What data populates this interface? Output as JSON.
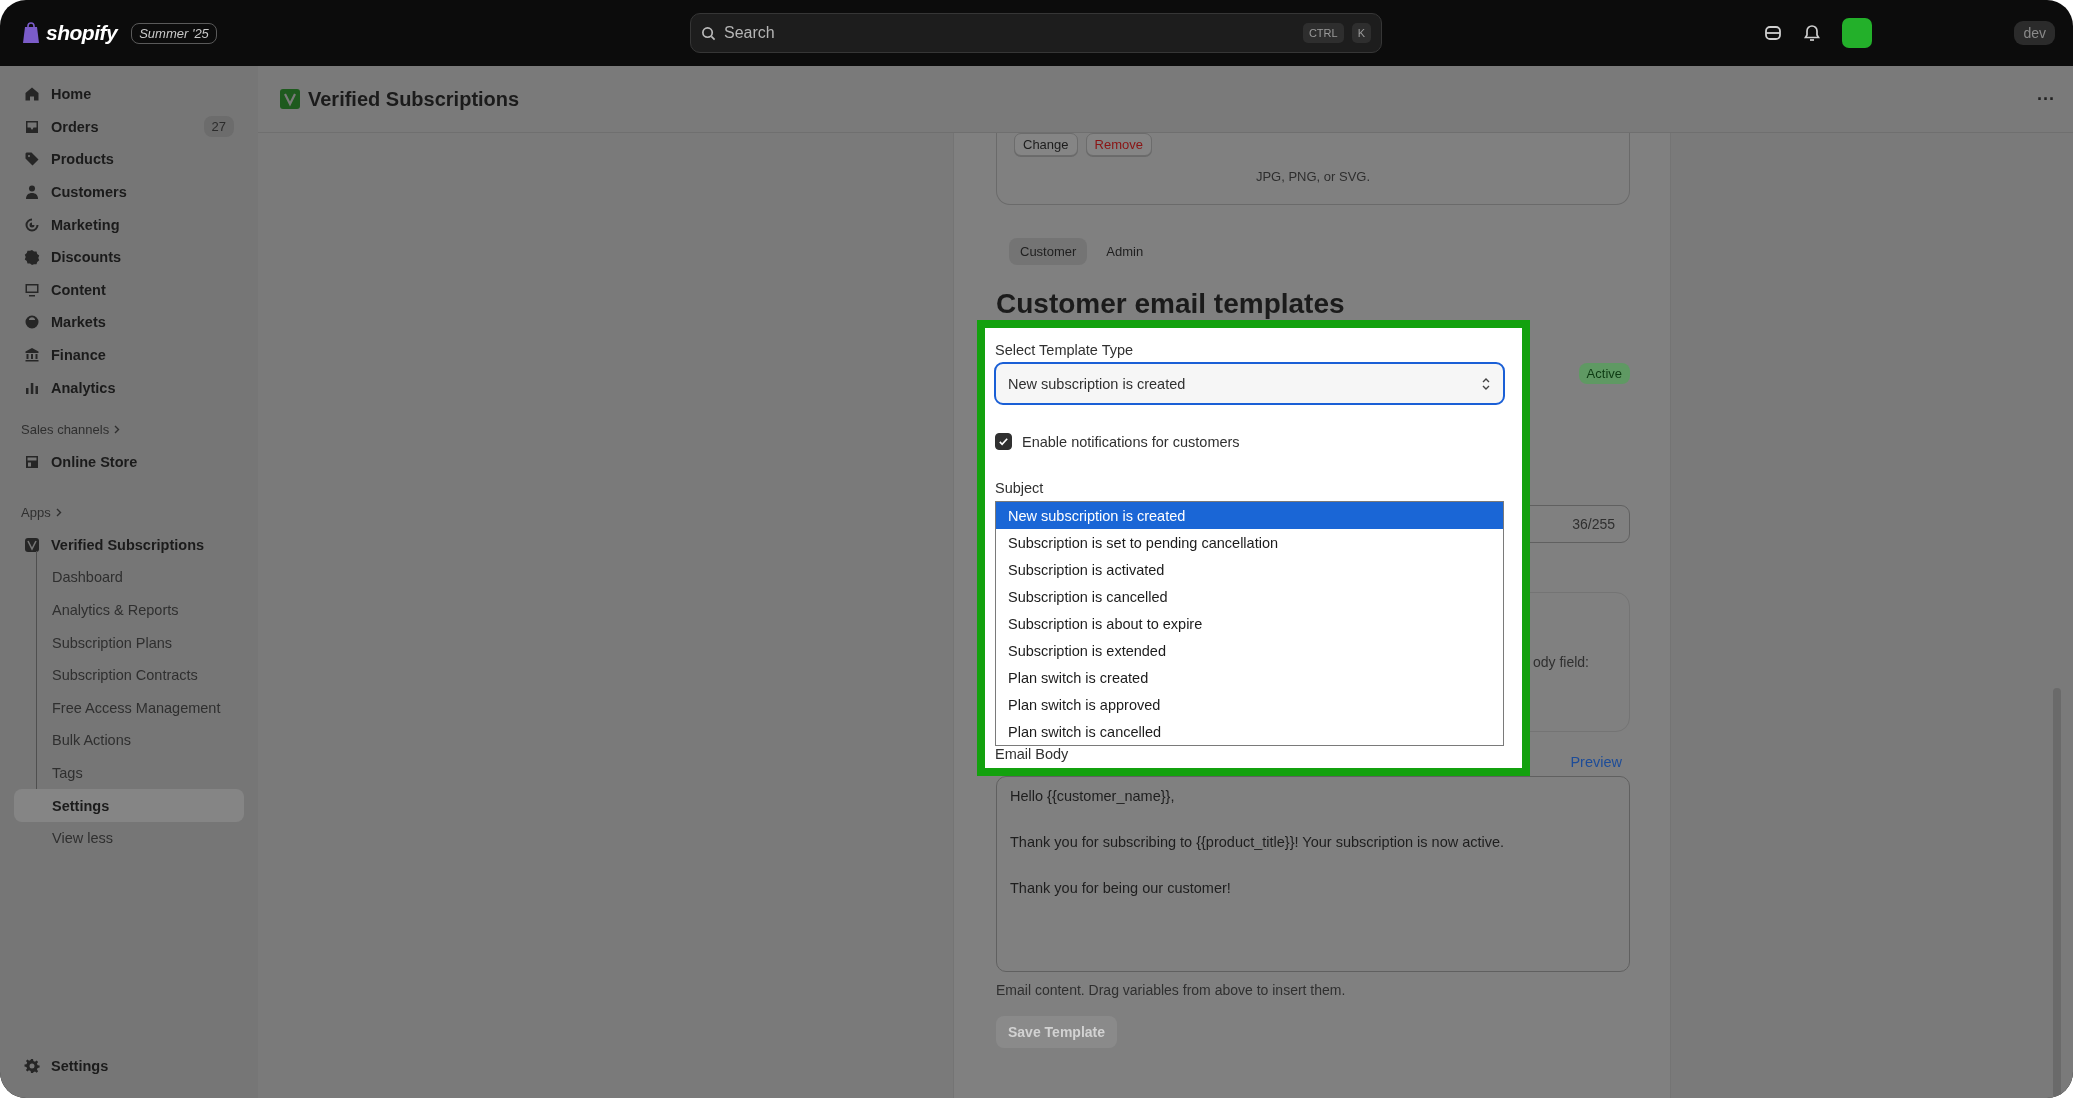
{
  "topbar": {
    "brand": "shopify",
    "edition": "Summer '25",
    "search": {
      "placeholder": "Search"
    },
    "shortcut": [
      "CTRL",
      "K"
    ],
    "account_badge": "dev"
  },
  "sidebar": {
    "items": [
      {
        "label": "Home",
        "selected": false
      },
      {
        "label": "Orders",
        "badge": "27",
        "selected": false
      },
      {
        "label": "Products",
        "selected": false
      },
      {
        "label": "Customers",
        "selected": false
      },
      {
        "label": "Marketing",
        "selected": false
      },
      {
        "label": "Discounts",
        "selected": false
      },
      {
        "label": "Content",
        "selected": false
      },
      {
        "label": "Markets",
        "selected": false
      },
      {
        "label": "Finance",
        "selected": false
      },
      {
        "label": "Analytics",
        "selected": false
      }
    ],
    "sales_channels": {
      "title": "Sales channels",
      "items": [
        {
          "label": "Online Store",
          "selected": false
        }
      ]
    },
    "apps": {
      "title": "Apps",
      "app": {
        "label": "Verified Subscriptions",
        "children": [
          {
            "label": "Dashboard",
            "selected": false
          },
          {
            "label": "Analytics & Reports",
            "selected": false
          },
          {
            "label": "Subscription Plans",
            "selected": false
          },
          {
            "label": "Subscription Contracts",
            "selected": false
          },
          {
            "label": "Free Access Management",
            "selected": false
          },
          {
            "label": "Bulk Actions",
            "selected": false
          },
          {
            "label": "Tags",
            "selected": false
          },
          {
            "label": "Settings",
            "selected": true
          }
        ]
      },
      "toggle": "View less"
    },
    "footer": {
      "label": "Settings"
    }
  },
  "page": {
    "title": "Verified Subscriptions",
    "more": "···"
  },
  "card": {
    "logo_upload": {
      "buttons": [
        {
          "label": "Change",
          "kind": "default"
        },
        {
          "label": "Remove",
          "kind": "critical"
        }
      ],
      "hint": "JPG, PNG, or SVG."
    },
    "tabs": [
      {
        "label": "Customer",
        "selected": true
      },
      {
        "label": "Admin",
        "selected": false
      }
    ],
    "heading": "Customer email templates",
    "status_badge": "Active",
    "subject_counter": "36/255",
    "variables_hint": "ody field:",
    "preview_link": "Preview",
    "email_body": {
      "value": "Hello {{customer_name}},\n\nThank you for subscribing to {{product_title}}! Your subscription is now active.\n\nThank you for being our customer!"
    },
    "help_text": "Email content. Drag variables from above to insert them.",
    "save_button": {
      "label": "Save Template",
      "disabled": true
    }
  },
  "highlight": {
    "select_label": "Select Template Type",
    "select_value": "New subscription is created",
    "checkbox": {
      "label": "Enable notifications for customers",
      "checked": true
    },
    "subject_label": "Subject",
    "options": [
      {
        "label": "New subscription is created",
        "selected": true
      },
      {
        "label": "Subscription is set to pending cancellation",
        "selected": false
      },
      {
        "label": "Subscription is activated",
        "selected": false
      },
      {
        "label": "Subscription is cancelled",
        "selected": false
      },
      {
        "label": "Subscription is about to expire",
        "selected": false
      },
      {
        "label": "Subscription is extended",
        "selected": false
      },
      {
        "label": "Plan switch is created",
        "selected": false
      },
      {
        "label": "Plan switch is approved",
        "selected": false
      },
      {
        "label": "Plan switch is cancelled",
        "selected": false
      }
    ],
    "email_body_label": "Email Body"
  }
}
